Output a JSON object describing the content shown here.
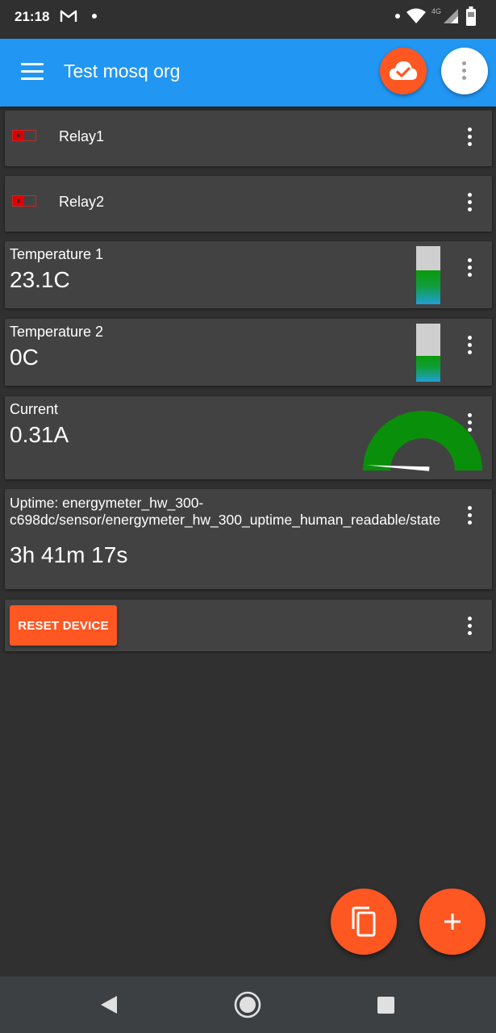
{
  "status_bar": {
    "time": "21:18",
    "network_label": "4G",
    "icons": [
      "gmail-icon",
      "notification-dot-icon",
      "wifi-icon",
      "signal-icon",
      "battery-icon"
    ]
  },
  "app_bar": {
    "title": "Test mosq org",
    "icons": [
      "menu-icon",
      "cloud-check-icon",
      "more-vert-icon"
    ],
    "colors": {
      "bar": "#2196f3",
      "accent": "#ff5722"
    }
  },
  "widgets": {
    "relay1": {
      "label": "Relay1",
      "state": "off"
    },
    "relay2": {
      "label": "Relay2",
      "state": "off"
    },
    "temperature1": {
      "title": "Temperature 1",
      "value": "23.1C",
      "level": 0.58
    },
    "temperature2": {
      "title": "Temperature 2",
      "value": "0C",
      "level": 0.45
    },
    "current": {
      "title": "Current",
      "value": "0.31A",
      "gauge_level": 0.03
    },
    "uptime": {
      "title_line1": "Uptime: energymeter_hw_300-",
      "title_line2": "c698dc/sensor/energymeter_hw_300_uptime_human_readable/state",
      "value": "3h 41m 17s"
    },
    "reset": {
      "button_label": "RESET DEVICE"
    }
  },
  "fabs": [
    "copy-icon",
    "add-icon"
  ],
  "nav_bar": [
    "back-icon",
    "home-icon",
    "recents-icon"
  ]
}
